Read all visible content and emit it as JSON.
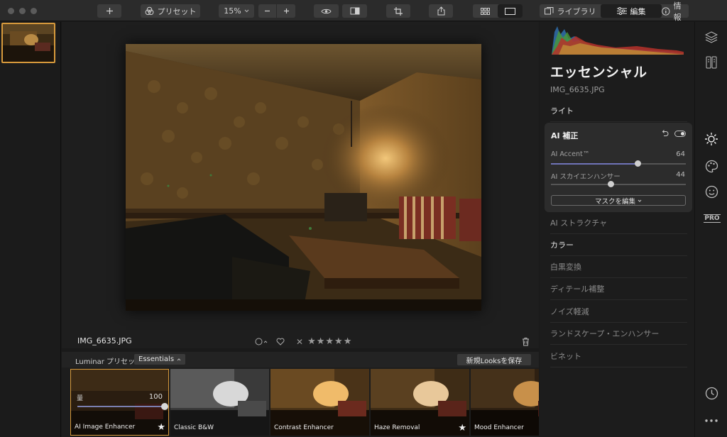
{
  "toolbar": {
    "presets_label": "プリセット",
    "zoom_value": "15%",
    "library_label": "ライブラリ",
    "edit_label": "編集",
    "info_label": "情報",
    "icons": [
      "add-icon",
      "presets-icon",
      "eye-icon",
      "compare-icon",
      "crop-icon",
      "share-icon",
      "grid-view-icon",
      "single-view-icon",
      "library-icon",
      "sliders-icon",
      "info-icon"
    ]
  },
  "canvas": {
    "file_name": "IMG_6635.JPG",
    "stars": [
      "★",
      "★",
      "★",
      "★",
      "★"
    ],
    "reject": "✕"
  },
  "presets_bar": {
    "label": "Luminar プリセット",
    "category": "Essentials",
    "save_looks": "新規Looksを保存"
  },
  "presets": [
    {
      "name": "AI Image Enhancer",
      "amount_label": "量",
      "amount_value": "100",
      "amount": 1.0,
      "star": "★"
    },
    {
      "name": "Classic B&W"
    },
    {
      "name": "Contrast Enhancer"
    },
    {
      "name": "Haze Removal",
      "star": "★"
    },
    {
      "name": "Mood Enhancer"
    }
  ],
  "panel": {
    "title": "エッセンシャル",
    "file_name": "IMG_6635.JPG",
    "light": "ライト",
    "ai_card": {
      "title": "AI 補正",
      "accent_label": "AI Accent™",
      "accent_value": "64",
      "accent": 0.64,
      "sky_label": "AI スカイエンハンサー",
      "sky_value": "44",
      "sky": 0.44,
      "mask_button": "マスクを編集"
    },
    "sections": [
      "AI ストラクチャ",
      "カラー",
      "白黒変換",
      "ディテール補整",
      "ノイズ軽減",
      "ランドスケープ・エンハンサー",
      "ビネット"
    ]
  },
  "rail": {
    "icons": [
      "layers-icon",
      "canvas-icon",
      "essentials-sun-icon",
      "creative-palette-icon",
      "portrait-face-icon",
      "pro-icon",
      "history-clock-icon",
      "more-icon"
    ],
    "pro_label": "PRO"
  },
  "colors": {
    "accent_orange": "#d79a3c",
    "slider_blue": "#6f73b8"
  }
}
